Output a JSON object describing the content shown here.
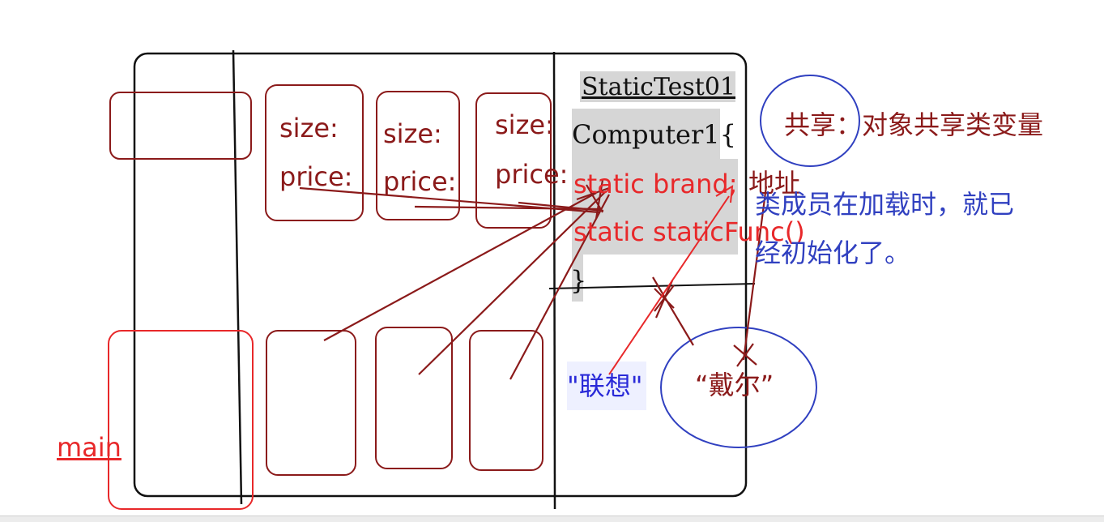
{
  "main_label": "main",
  "object_fields": {
    "size_label": "size:",
    "price_label": "price:"
  },
  "class_area": {
    "title": "StaticTest01",
    "class_decl": "Computer1{",
    "static_brand": "static brand;",
    "address_label": "地址",
    "static_func": "static staticFunc()",
    "close_brace": "}"
  },
  "values": {
    "lenovo": "\"联想\"",
    "dell": "“戴尔”"
  },
  "notes": {
    "shared": "共享：对象共享类变量",
    "init_line1": "类成员在加载时，就已",
    "init_line2": "经初始化了。"
  },
  "colors": {
    "dark_red": "#8b1a1a",
    "red": "#e8282a",
    "blue": "#2a2ad8",
    "navy_blue": "#3040c0",
    "black": "#111111",
    "gray_highlight": "#d6d6d6"
  }
}
